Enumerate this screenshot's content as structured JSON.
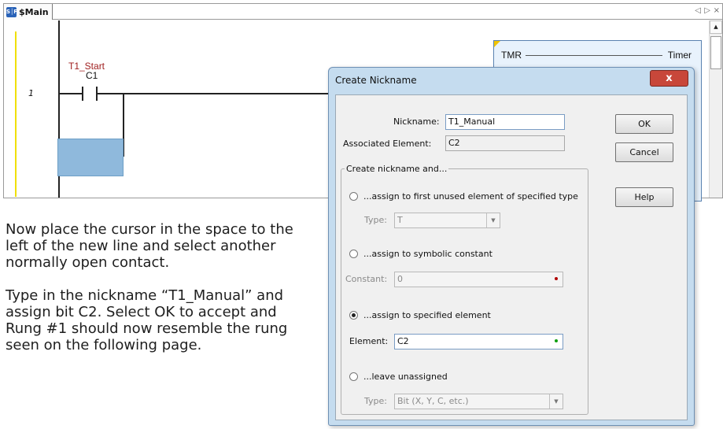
{
  "editor": {
    "tab_label": "$Main",
    "tab_icon_text": "S│F",
    "tab_prev": "◁",
    "tab_next": "▷",
    "tab_close": "×",
    "rung_number": "1",
    "contact": {
      "nickname": "T1_Start",
      "address": "C1"
    },
    "timer": {
      "type": "TMR",
      "name": "Timer"
    },
    "scroll_up": "▲"
  },
  "instructions": [
    "Now place the cursor in the space to the left of the new line and select another normally open contact.",
    "Type in the nickname “T1_Manual” and assign bit C2.  Select OK to accept and Rung #1 should now resemble the rung seen on the following page."
  ],
  "dialog": {
    "title": "Create Nickname",
    "close": "x",
    "nickname_label": "Nickname:",
    "nickname_value": "T1_Manual",
    "associated_label": "Associated Element:",
    "associated_value": "C2",
    "group_title": "Create nickname and...",
    "options": {
      "first_unused": {
        "label": "...assign to first unused element of specified type",
        "field_label": "Type:",
        "field_value": "T",
        "selected": false
      },
      "symbolic": {
        "label": "...assign to symbolic constant",
        "field_label": "Constant:",
        "field_value": "0",
        "selected": false
      },
      "specified": {
        "label": "...assign to specified element",
        "field_label": "Element:",
        "field_value": "C2",
        "selected": true
      },
      "unassigned": {
        "label": "...leave unassigned",
        "field_label": "Type:",
        "field_value": "Bit (X, Y, C, etc.)",
        "selected": false
      }
    },
    "buttons": {
      "ok": "OK",
      "cancel": "Cancel",
      "help": "Help"
    },
    "dot_red": "#b00000",
    "dot_green": "#10a010"
  },
  "colors": {
    "contact_nickname": "#a02020",
    "cursor_fill": "#8fb9dc",
    "rail": "#f0e000"
  }
}
